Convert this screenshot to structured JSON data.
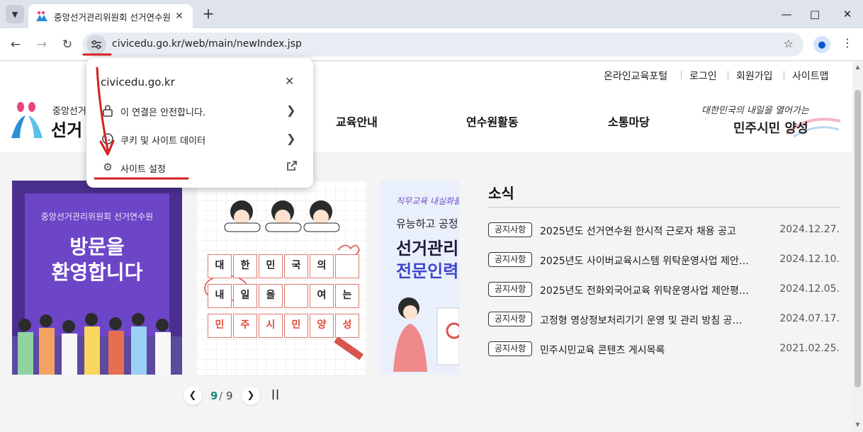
{
  "browser": {
    "tab_title": "중앙선거관리위원회 선거연수원",
    "new_tab_symbol": "+",
    "url": "civicedu.go.kr/web/main/newIndex.jsp"
  },
  "header": {
    "util_links": [
      "온라인교육포털",
      "로그인",
      "회원가입",
      "사이트맵"
    ],
    "logo_small": "중앙선거",
    "logo_big": "선거",
    "nav": [
      "교육안내",
      "연수원활동",
      "소통마당"
    ],
    "slogan_line1": "대한민국의 내일을 열어가는",
    "slogan_line2": "민주시민 양성"
  },
  "banners": {
    "b1_org": "중앙선거관리위원회 선거연수원",
    "b1_line1": "방문을",
    "b1_line2": "환영합니다",
    "b2_rows": [
      [
        "대",
        "한",
        "민",
        "국",
        "의",
        ""
      ],
      [
        "내",
        "일",
        "을",
        "",
        "여",
        "는"
      ],
      [
        "민",
        "주",
        "시",
        "민",
        "양",
        "성"
      ]
    ],
    "b3_line1": "직무교육 내실화를",
    "b3_line2": "유능하고 공정",
    "b3_line3": "선거관리",
    "b3_line4": "전문인력"
  },
  "pager": {
    "current": "9",
    "separator": "/",
    "total": "9"
  },
  "news": {
    "title": "소식",
    "items": [
      {
        "badge": "공지사항",
        "text": "2025년도 선거연수원 한시적 근로자 채용 공고",
        "date": "2024.12.27."
      },
      {
        "badge": "공지사항",
        "text": "2025년도 사이버교육시스템 위탁운영사업 제안…",
        "date": "2024.12.10."
      },
      {
        "badge": "공지사항",
        "text": "2025년도 전화외국어교육 위탁운영사업 제안평…",
        "date": "2024.12.05."
      },
      {
        "badge": "공지사항",
        "text": "고정형 영상정보처리기기 운영 및 관리 방침 공…",
        "date": "2024.07.17."
      },
      {
        "badge": "공지사항",
        "text": "민주시민교육 콘텐츠 게시목록",
        "date": "2021.02.25."
      }
    ]
  },
  "popup": {
    "domain": "civicedu.go.kr",
    "rows": [
      {
        "label": "이 연결은 안전합니다.",
        "icon": "lock-icon"
      },
      {
        "label": "쿠키 및 사이트 데이터",
        "icon": "cookie-icon"
      },
      {
        "label": "사이트 설정",
        "icon": "gear-icon"
      }
    ]
  },
  "colors": {
    "annotation": "#d42020",
    "accent_teal": "#17897f",
    "purple": "#6d46c7"
  }
}
